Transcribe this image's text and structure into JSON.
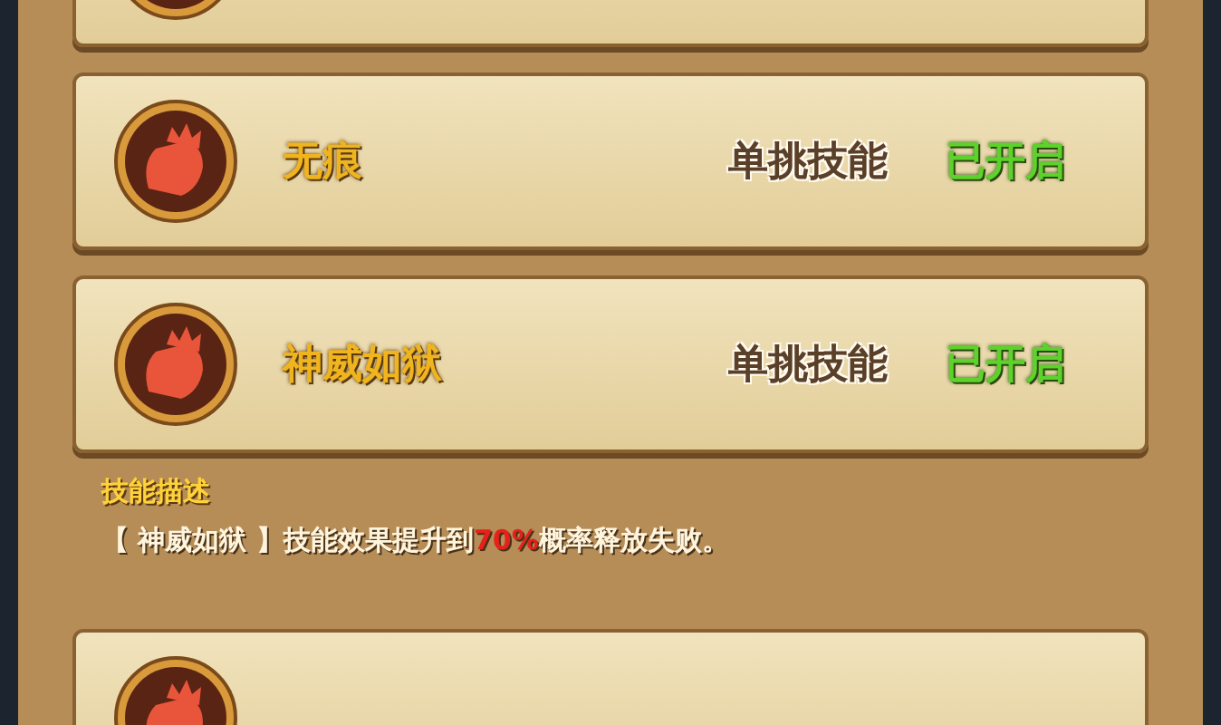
{
  "skills": [
    {
      "name": "无痕",
      "type": "单挑技能",
      "status": "已开启"
    },
    {
      "name": "神威如狱",
      "type": "单挑技能",
      "status": "已开启",
      "description": {
        "title": "技能描述",
        "parts": [
          {
            "text": "【 神威如狱 】技能效果提升到",
            "highlight": false
          },
          {
            "text": "70%",
            "highlight": true
          },
          {
            "text": "概率释放失败。",
            "highlight": false
          }
        ]
      }
    }
  ]
}
